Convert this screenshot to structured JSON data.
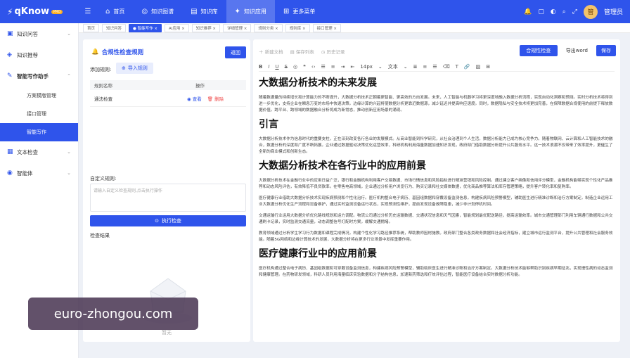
{
  "app": {
    "logo_mark": "⚡",
    "logo_name": "qKnow",
    "logo_badge": "PRO",
    "user_name": "管理员",
    "avatar_text": "管"
  },
  "topnav": [
    {
      "label": "首页",
      "icon": "home-icon",
      "glyph": "⌂"
    },
    {
      "label": "知识图谱",
      "icon": "graph-icon",
      "glyph": "◎"
    },
    {
      "label": "知识库",
      "icon": "book-icon",
      "glyph": "▤"
    },
    {
      "label": "知识应用",
      "icon": "app-icon",
      "glyph": "✦"
    },
    {
      "label": "更多菜单",
      "icon": "grid-icon",
      "glyph": "⊞"
    }
  ],
  "sidebar": {
    "items": [
      {
        "label": "知识问答",
        "glyph": "▣"
      },
      {
        "label": "知识推荐",
        "glyph": "◈"
      },
      {
        "label": "智能写作助手",
        "glyph": "✎"
      },
      {
        "label": "文本检查",
        "glyph": "▦"
      },
      {
        "label": "智能体",
        "glyph": "◉"
      }
    ],
    "subitems": [
      "方案模版管理",
      "接口管理",
      "智能写作"
    ]
  },
  "tabs": [
    "首页",
    "知识问答",
    "● 智能写作 ×",
    "AI应用 ×",
    "知识推荐 ×",
    "详细管理 ×",
    "规则分类 ×",
    "规则库 ×",
    "接口管理 ×"
  ],
  "left": {
    "title": "合规性检查规则",
    "back": "返回",
    "add_label": "添加规则:",
    "import_label": "导入规则",
    "table_headers": [
      "规则名称",
      "操作"
    ],
    "rows": [
      {
        "name": "通法检查",
        "view": "查看",
        "del": "删除"
      }
    ],
    "custom_label": "自定义规则:",
    "custom_placeholder": "请输入自定义检查规则,点击执行操作",
    "exec_label": "执行检查",
    "result_label": "检查结果",
    "empty_text": "暂无"
  },
  "editor": {
    "actions": [
      "新建文档",
      "保存列表",
      "历史记录"
    ],
    "check_btn": "合规性检查",
    "export_btn": "导出word",
    "save_btn": "保存",
    "toolbar_font_size": "14px",
    "toolbar_style": "文本",
    "content": [
      {
        "type": "h",
        "text": "大数据分析技术的未来发展"
      },
      {
        "type": "p",
        "text": "随着数据量的持续增长和计算能力的不断提升，大数据分析技术正朝着更智能、更高效的方向发展。未来，人工智能与机器学习将更深度地融入数据分析流程，实现自动化洞察和预测。实时分析技术将得到进一步优化，支持企业在瞬息万变的市场中快速决策。边缘计算的兴起将使数据分析更靠近数据源，减少延迟并提高响应速度。同时，数据隐私与安全技术将更加完善，在保障数据合规使用的前提下释放数据价值。跨平台、跨领域的数据融合分析将成为新常态，推动创新应用场景的涌现。"
      },
      {
        "type": "h",
        "text": "引言"
      },
      {
        "type": "p",
        "text": "大数据分析技术作为信息时代的重要支柱，正在深刻改变各行各业的发展模式。从商业智能到科学研究，从社会治理到个人生活，数据分析能力已成为核心竞争力。随着物联网、云计算和人工智能技术的融合，数据分析的深度和广度不断拓展。企业通过数据驱动决策优化运营效率，科研机构利用海量数据加速知识发现，政府部门借助数据分析提升公共服务水平。这一技术浪潮不仅带来了效率提升，更催生了全新的商业模式和创新生态。"
      },
      {
        "type": "h",
        "text": "大数据分析技术在各行业中的应用前景"
      },
      {
        "type": "p",
        "text": "大数据分析技术在金融行业中的应用日益广泛，银行和金融机构利用客户交易数据、市场行情信息和风险指标进行精准营销和风险控制。通过建立客户画像和信用评分模型，金融机构能够实现个性化产品推荐和动态风险评估，有效降低不良贷款率。在零售电商领域，企业通过分析用户浏览行为、购买记录和社交媒体数据，优化商品推荐算法和库存管理策略，提升客户转化率和复购率。"
      },
      {
        "type": "p",
        "text": "医疗健康行业借助大数据分析技术实现疾病预测和个性化治疗。医疗机构整合电子病历、基因组数据和穿戴设备监测信息，构建疾病风险预警模型，辅助医生进行精准诊断和治疗方案制定。制造企业运用工业大数据分析优化生产流程和设备维护，通过实时监测设备运行状态，实现预测性维护，提前发现设备故障隐患，减少非计划停机时间。"
      },
      {
        "type": "p",
        "text": "交通运输行业运用大数据分析优化路线规划和运力调配。物流公司通过分析历史运输数据、交通状况信息和天气因素，智能规划最优配送路径，提高运输效率。城市交通管理部门利用车辆通行数据和公共交通刷卡记录，实时监测交通流量，动态调整信号灯配时方案，缓解交通拥堵。"
      },
      {
        "type": "p",
        "text": "教育领域通过分析学生学习行为数据和课程完成情况，构建个性化学习路径推荐系统，帮助教师因材施教。政府部门整合各类政务数据和社会经济指标，建立城市运行监测平台，提升公共管理和社会服务效能。随着5G网络和边缘计算技术的发展，大数据分析将在更多行业场景中发挥重要作用。"
      },
      {
        "type": "h",
        "text": "医疗健康行业中的应用前景"
      },
      {
        "type": "p",
        "text": "医疗机构通过整合电子病历、基因组数据和可穿戴设备监测信息，构建疾病风险预警模型，辅助临床医生进行精准诊断和治疗方案制定。大数据分析技术能够帮助识别疾病早期征兆，实现慢性病的动态监测和健康管理。在药物研发领域，科研人员利用海量临床实验数据和分子结构信息，加速新药筛选和疗效评估过程，智能医疗设备结合实时数据分析功能。"
      }
    ]
  },
  "watermark": "euro-zhongou.com",
  "colors": {
    "primary": "#2f54eb",
    "danger": "#f04848"
  }
}
